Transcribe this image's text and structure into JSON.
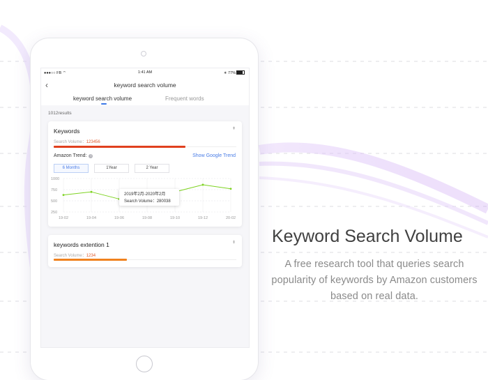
{
  "status_bar": {
    "carrier": "FB",
    "time": "1:41 AM",
    "battery": "77%"
  },
  "nav": {
    "title": "keyword search volume",
    "tabs": [
      {
        "label": "keyword search volume",
        "active": true
      },
      {
        "label": "Frequent words",
        "active": false
      }
    ]
  },
  "results_count": "1012results",
  "cards": [
    {
      "title": "Keywords",
      "sv_label": "Search Volume：",
      "sv_value": "123456",
      "bar_color": "#e0401e",
      "bar_fraction": 0.72,
      "trend_label": "Amazon Trend:",
      "google_link": "Show Google Trend",
      "ranges": [
        {
          "label": "6 Months",
          "active": true
        },
        {
          "label": "1Year",
          "active": false
        },
        {
          "label": "2 Year",
          "active": false
        }
      ]
    },
    {
      "title": "keywords extention 1",
      "sv_label": "Search Volume：",
      "sv_value": "1234",
      "bar_color": "#f0821e",
      "bar_fraction": 0.4
    }
  ],
  "tooltip": {
    "period": "2019年2月-2020年2月",
    "volume_line": "Search Volume：280038"
  },
  "chart_data": {
    "type": "line",
    "x": [
      "19-02",
      "19-04",
      "19-06",
      "19-08",
      "19-10",
      "19-12",
      "20-02"
    ],
    "series": [
      {
        "values": [
          630,
          700,
          540,
          490,
          700,
          860,
          770
        ]
      }
    ],
    "ylim": [
      250,
      1000
    ],
    "yticks": [
      1000,
      750,
      500,
      250
    ],
    "line_color": "#7ed321",
    "grid": true
  },
  "promo": {
    "headline": "Keyword Search Volume",
    "subtext": "A free research tool that queries search popularity of keywords by Amazon customers based on real data."
  },
  "colors": {
    "accent": "#4a7de6",
    "brand_purple": "#c9a3f0"
  }
}
